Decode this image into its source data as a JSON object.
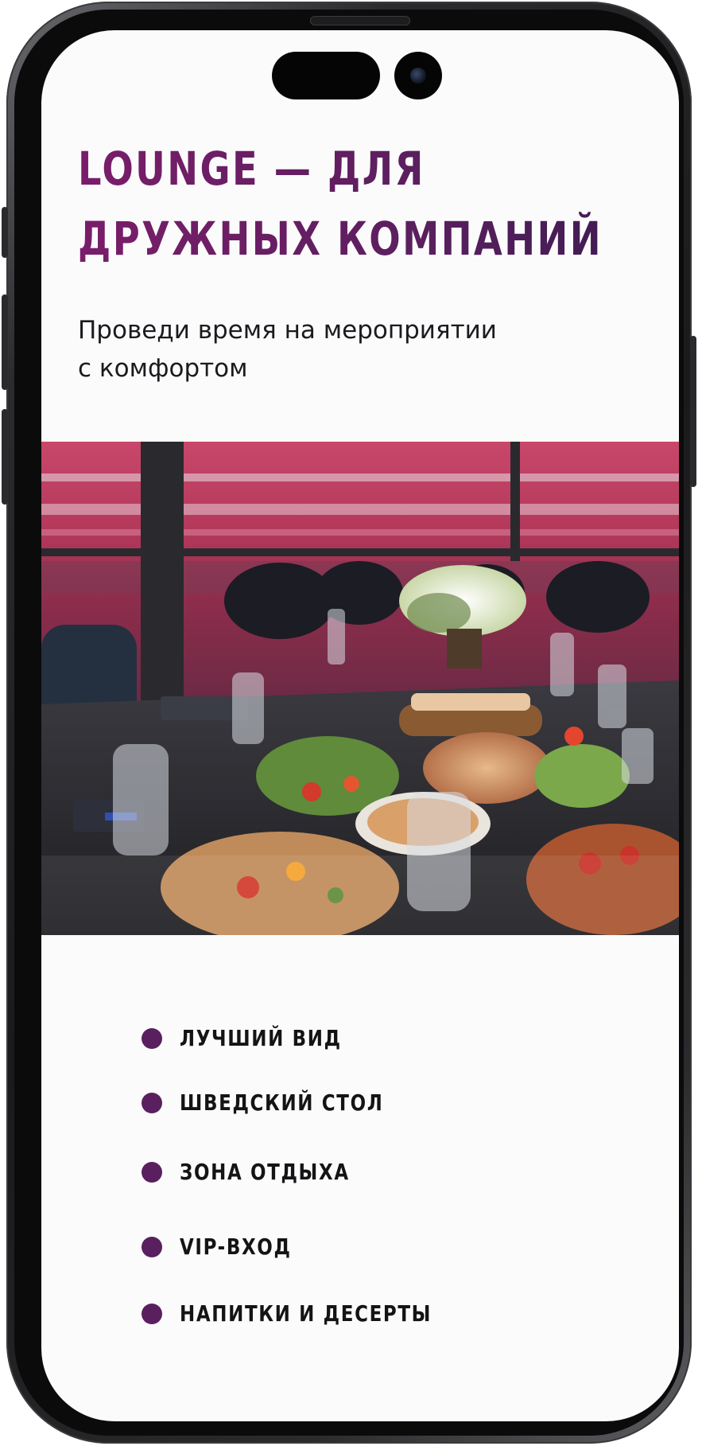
{
  "hero": {
    "title_line1": "LOUNGE — ДЛЯ",
    "title_line2": "ДРУЖНЫХ КОМПАНИЙ",
    "subtitle_line1": "Проведи время на мероприятии",
    "subtitle_line2": "с комфортом"
  },
  "features": [
    {
      "label": "ЛУЧШИЙ ВИД"
    },
    {
      "label": "ШВЕДСКИЙ СТОЛ"
    },
    {
      "label": "ЗОНА ОТДЫХА"
    },
    {
      "label": "VIP-ВХОД"
    },
    {
      "label": "НАПИТКИ И ДЕСЕРТЫ"
    }
  ],
  "colors": {
    "accent": "#5a1f5e",
    "title_gradient_start": "#7a1d6a",
    "title_gradient_end": "#3d1a52",
    "screen_background": "#fbfbfc",
    "text": "#1b1b1f"
  },
  "icons": {
    "bullet": "circle-bullet-icon",
    "camera": "front-camera-icon"
  }
}
